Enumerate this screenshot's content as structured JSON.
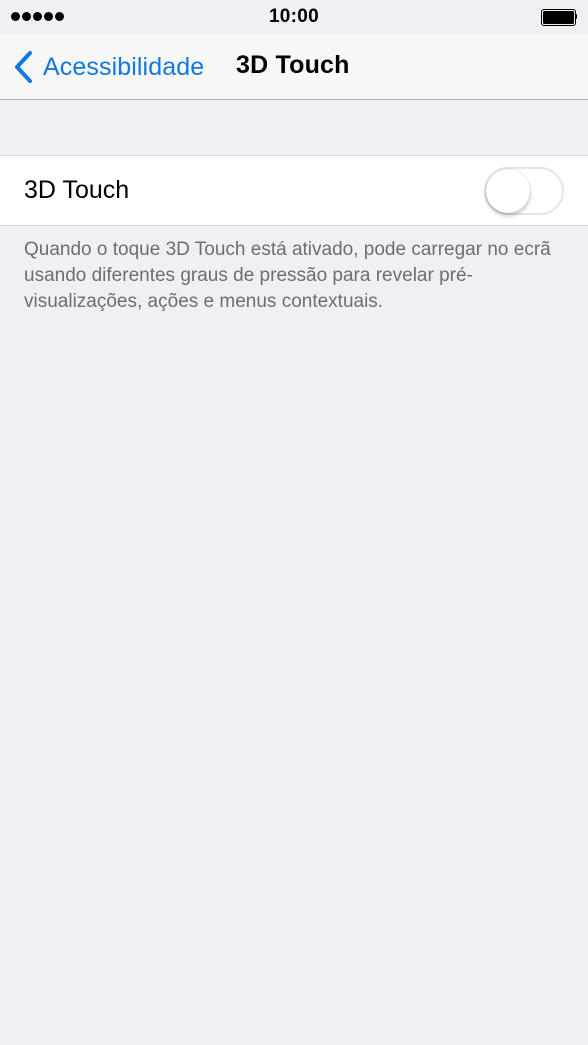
{
  "status_bar": {
    "signal_icon": "signal-dots-icon",
    "time": "10:00",
    "battery_icon": "battery-icon"
  },
  "nav": {
    "back_icon": "chevron-left-icon",
    "back_label": "Acessibilidade",
    "title": "3D Touch"
  },
  "settings": {
    "row_label": "3D Touch",
    "toggle_on": false,
    "footer": "Quando o toque 3D Touch está ativado, pode carregar no ecrã usando diferentes graus de pressão para revelar pré-visualizações, ações e menus contextuais."
  },
  "colors": {
    "accent": "#1278de",
    "background": "#efeff4",
    "footer_text": "#6d6d72"
  }
}
